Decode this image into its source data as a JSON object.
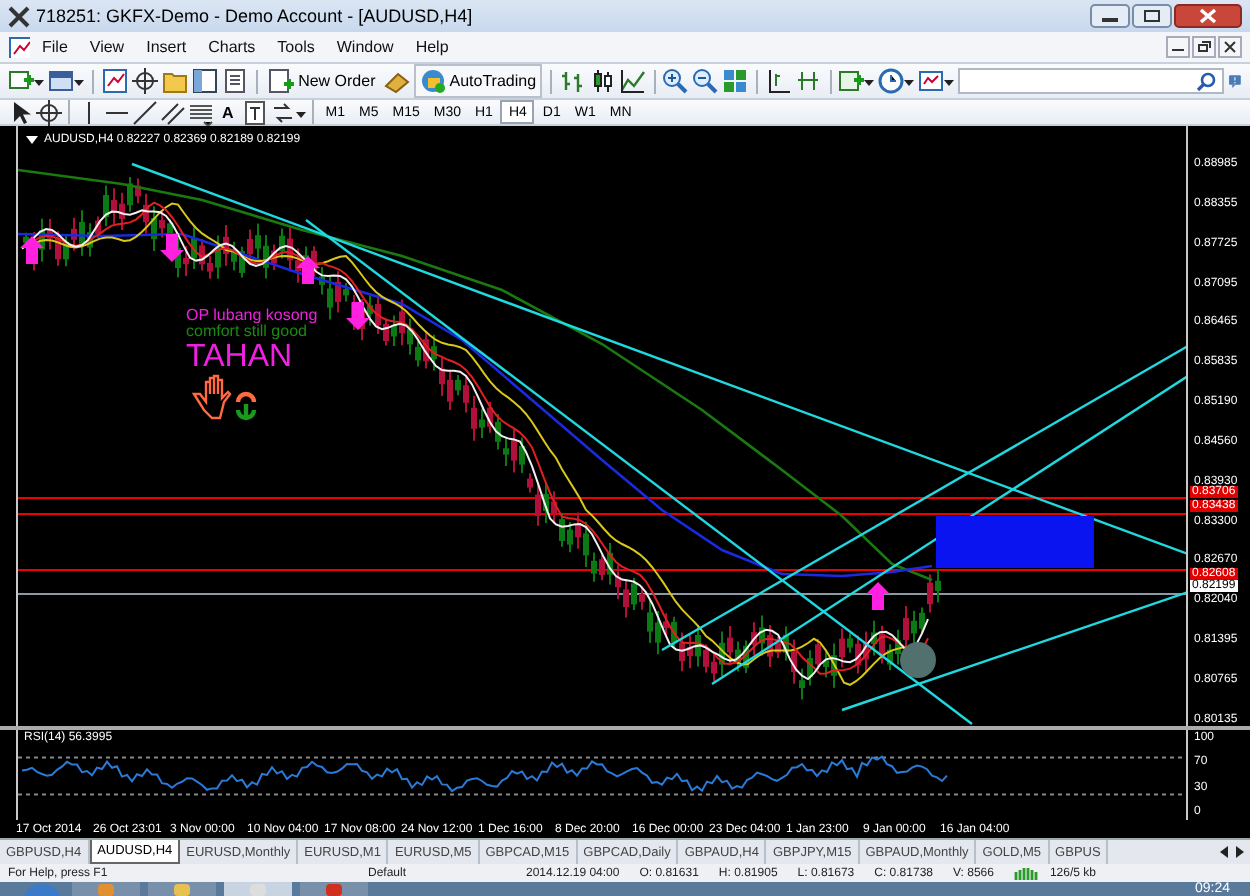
{
  "window": {
    "title": "718251: GKFX-Demo - Demo Account - [AUDUSD,H4]"
  },
  "menu": [
    "File",
    "View",
    "Insert",
    "Charts",
    "Tools",
    "Window",
    "Help"
  ],
  "toolbar": {
    "new_order": "New Order",
    "autotrading": "AutoTrading"
  },
  "drawing_toolbar": {
    "text_tool": "A"
  },
  "timeframes": [
    {
      "label": "M1",
      "selected": false
    },
    {
      "label": "M5",
      "selected": false
    },
    {
      "label": "M15",
      "selected": false
    },
    {
      "label": "M30",
      "selected": false
    },
    {
      "label": "H1",
      "selected": false
    },
    {
      "label": "H4",
      "selected": true
    },
    {
      "label": "D1",
      "selected": false
    },
    {
      "label": "W1",
      "selected": false
    },
    {
      "label": "MN",
      "selected": false
    }
  ],
  "chart": {
    "header": "AUDUSD,H4  0.82227 0.82369 0.82189 0.82199",
    "notes": [
      {
        "kind": "label",
        "text": "OP lubang kosong"
      },
      {
        "kind": "comment",
        "text": "comfort still good"
      },
      {
        "kind": "headline",
        "text": "TAHAN"
      }
    ],
    "price_axis": [
      "0.88985",
      "0.88355",
      "0.87725",
      "0.87095",
      "0.86465",
      "0.85835",
      "0.85190",
      "0.84560",
      "0.83930",
      "0.83300",
      "0.82670",
      "0.82040",
      "0.81395",
      "0.80765",
      "0.80135"
    ],
    "price_markers": [
      {
        "kind": "line",
        "text": "0.83706"
      },
      {
        "kind": "line",
        "text": "0.83438"
      },
      {
        "kind": "line",
        "text": "0.82608"
      },
      {
        "kind": "bid",
        "text": "0.82199"
      }
    ]
  },
  "rsi": {
    "label": "RSI(14) 56.3995",
    "scale": [
      "100",
      "70",
      "30",
      "0"
    ]
  },
  "time_axis": [
    "17 Oct 2014",
    "26 Oct 23:01",
    "3 Nov 00:00",
    "10 Nov 04:00",
    "17 Nov 08:00",
    "24 Nov 12:00",
    "1 Dec 16:00",
    "8 Dec 20:00",
    "16 Dec 00:00",
    "23 Dec 04:00",
    "1 Jan 23:00",
    "9 Jan 00:00",
    "16 Jan 04:00"
  ],
  "tabs": [
    {
      "label": "GBPUSD,H4",
      "selected": false
    },
    {
      "label": "AUDUSD,H4",
      "selected": true
    },
    {
      "label": "EURUSD,Monthly",
      "selected": false
    },
    {
      "label": "EURUSD,M1",
      "selected": false
    },
    {
      "label": "EURUSD,M5",
      "selected": false
    },
    {
      "label": "GBPCAD,M15",
      "selected": false
    },
    {
      "label": "GBPCAD,Daily",
      "selected": false
    },
    {
      "label": "GBPAUD,H4",
      "selected": false
    },
    {
      "label": "GBPJPY,M15",
      "selected": false
    },
    {
      "label": "GBPAUD,Monthly",
      "selected": false
    },
    {
      "label": "GOLD,M5",
      "selected": false
    },
    {
      "label": "GBPUS",
      "selected": false
    }
  ],
  "status_bar": {
    "help": "For Help, press F1",
    "profile": "Default",
    "time": "2014.12.19 04:00",
    "open": "O: 0.81631",
    "high": "H: 0.81905",
    "low": "L: 0.81673",
    "close": "C: 0.81738",
    "volume": "V: 8566",
    "traffic": "126/5 kb"
  },
  "taskbar": {
    "clock": "09:24"
  }
}
